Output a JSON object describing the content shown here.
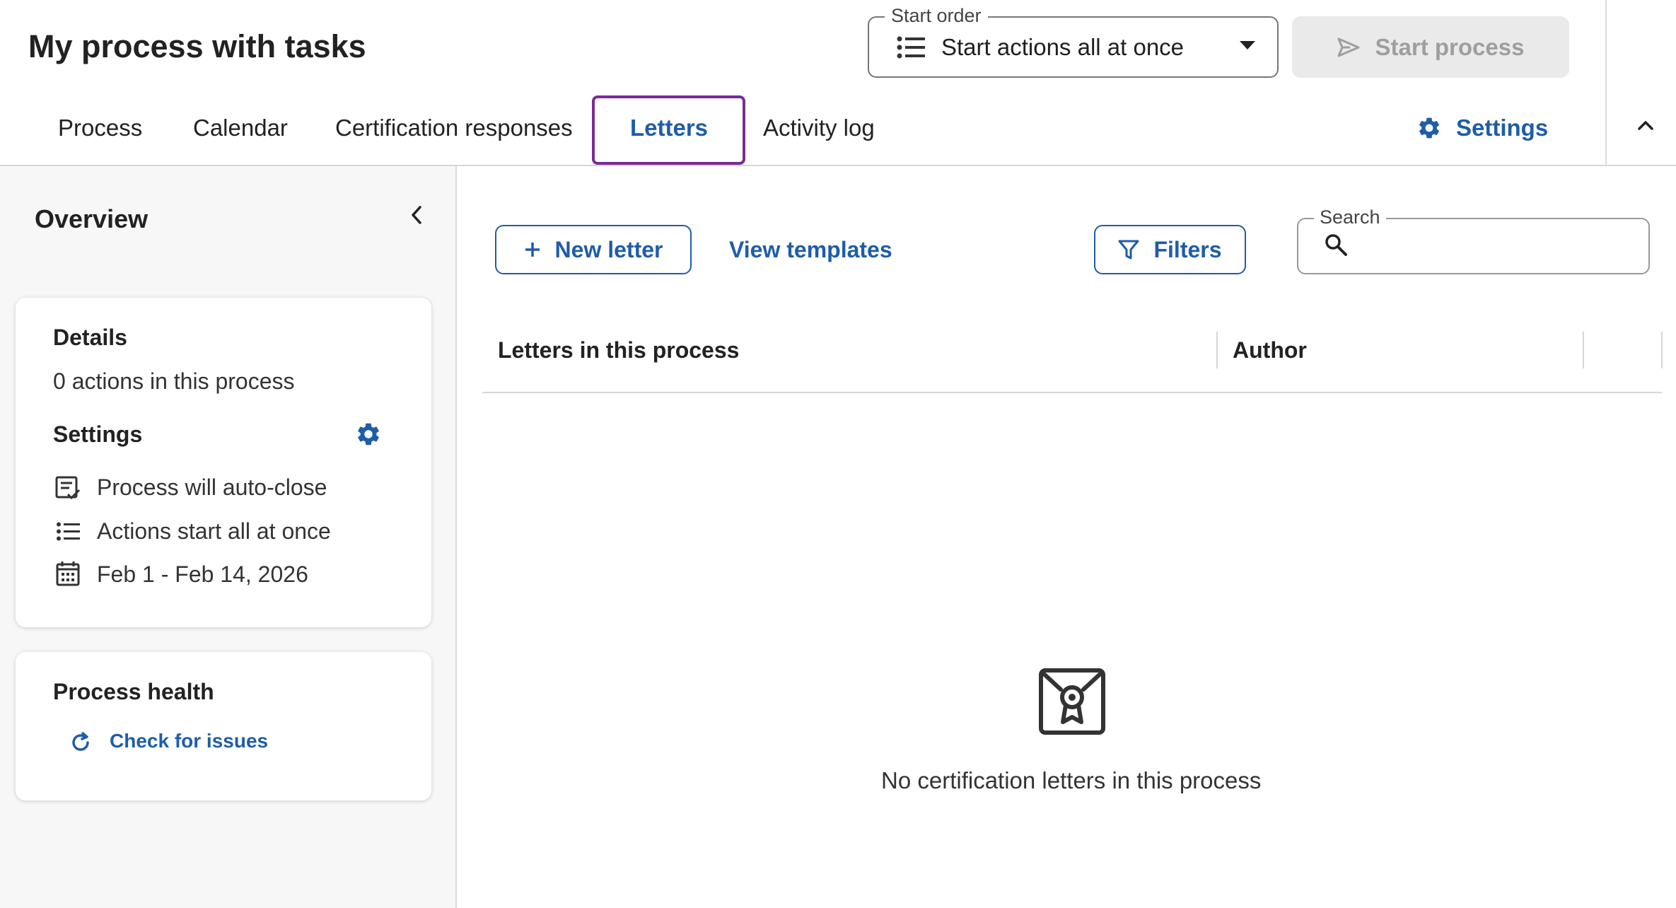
{
  "header": {
    "title": "My process with tasks",
    "start_order": {
      "legend": "Start order",
      "value": "Start actions all at once",
      "icon": "list-icon"
    },
    "start_button": {
      "label": "Start process",
      "icon": "send-icon",
      "disabled": true
    },
    "settings_link": {
      "label": "Settings",
      "icon": "gear-icon"
    },
    "collapse_icon": "chevron-up-icon"
  },
  "tabs": [
    {
      "label": "Process",
      "active": false
    },
    {
      "label": "Calendar",
      "active": false
    },
    {
      "label": "Certification responses",
      "active": false
    },
    {
      "label": "Letters",
      "active": true
    },
    {
      "label": "Activity log",
      "active": false
    }
  ],
  "overview": {
    "title": "Overview",
    "collapse_icon": "chevron-left-icon",
    "details": {
      "heading": "Details",
      "actions_count": "0 actions in this process",
      "settings_heading": "Settings",
      "settings_icon": "gear-icon",
      "items": [
        {
          "icon": "auto-close-icon",
          "text": "Process will auto-close"
        },
        {
          "icon": "list-icon",
          "text": "Actions start all at once"
        },
        {
          "icon": "calendar-icon",
          "text": "Feb 1 - Feb 14, 2026"
        }
      ]
    },
    "health": {
      "heading": "Process health",
      "check_link": "Check for issues",
      "check_icon": "refresh-icon"
    }
  },
  "letters": {
    "new_letter_label": "New letter",
    "view_templates_label": "View templates",
    "filters_label": "Filters",
    "search": {
      "legend": "Search",
      "value": ""
    },
    "columns": [
      "Letters in this process",
      "Author"
    ],
    "empty_message": "No certification letters in this process",
    "empty_icon": "certificate-envelope-icon"
  },
  "colors": {
    "accent": "#1f5da8",
    "active_tab_border": "#7a2b96",
    "disabled_button_bg": "#eaeaea",
    "panel_bg": "#f7f7f7"
  }
}
